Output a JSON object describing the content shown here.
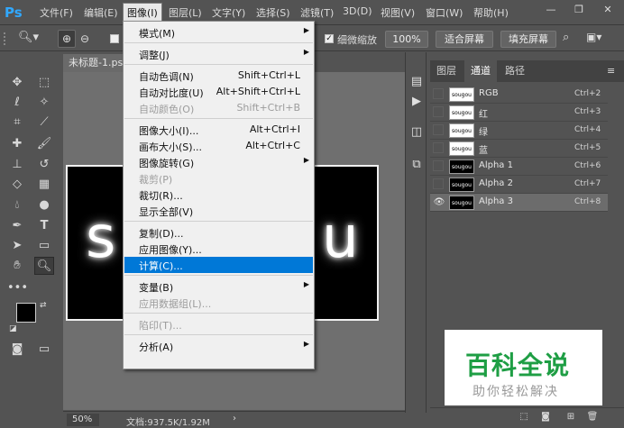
{
  "app": {
    "logo": "Ps",
    "menus": [
      "文件(F)",
      "编辑(E)",
      "图像(I)",
      "图层(L)",
      "文字(Y)",
      "选择(S)",
      "滤镜(T)",
      "3D(D)",
      "视图(V)",
      "窗口(W)",
      "帮助(H)"
    ],
    "active_menu": "图像(I)"
  },
  "options_bar": {
    "checkbox_label": "细微缩放",
    "zoom_value": "100%",
    "fit_screen": "适合屏幕",
    "fill_screen": "填充屏幕"
  },
  "document": {
    "tab_title": "未标题-1.psd",
    "image_text_left": "s",
    "image_text_right": "u",
    "zoom": "50%",
    "doc_info": "文档:937.5K/1.92M"
  },
  "image_menu": {
    "items": [
      {
        "label": "模式(M)",
        "shortcut": "",
        "submenu": true,
        "disabled": false
      },
      {
        "sep": true
      },
      {
        "label": "调整(J)",
        "shortcut": "",
        "submenu": true,
        "disabled": false
      },
      {
        "sep": true
      },
      {
        "label": "自动色调(N)",
        "shortcut": "Shift+Ctrl+L",
        "disabled": false
      },
      {
        "label": "自动对比度(U)",
        "shortcut": "Alt+Shift+Ctrl+L",
        "disabled": false
      },
      {
        "label": "自动颜色(O)",
        "shortcut": "Shift+Ctrl+B",
        "disabled": true
      },
      {
        "sep": true
      },
      {
        "label": "图像大小(I)...",
        "shortcut": "Alt+Ctrl+I",
        "disabled": false
      },
      {
        "label": "画布大小(S)...",
        "shortcut": "Alt+Ctrl+C",
        "disabled": false
      },
      {
        "label": "图像旋转(G)",
        "shortcut": "",
        "submenu": true,
        "disabled": false
      },
      {
        "label": "裁剪(P)",
        "shortcut": "",
        "disabled": true
      },
      {
        "label": "裁切(R)...",
        "shortcut": "",
        "disabled": false
      },
      {
        "label": "显示全部(V)",
        "shortcut": "",
        "disabled": false
      },
      {
        "sep": true
      },
      {
        "label": "复制(D)...",
        "shortcut": "",
        "disabled": false
      },
      {
        "label": "应用图像(Y)...",
        "shortcut": "",
        "disabled": false
      },
      {
        "label": "计算(C)...",
        "shortcut": "",
        "disabled": false,
        "highlighted": true
      },
      {
        "sep": true
      },
      {
        "label": "变量(B)",
        "shortcut": "",
        "submenu": true,
        "disabled": false
      },
      {
        "label": "应用数据组(L)...",
        "shortcut": "",
        "disabled": true
      },
      {
        "sep": true
      },
      {
        "label": "陷印(T)...",
        "shortcut": "",
        "disabled": true
      },
      {
        "sep": true
      },
      {
        "label": "分析(A)",
        "shortcut": "",
        "submenu": true,
        "disabled": false
      }
    ]
  },
  "panel": {
    "tabs": [
      "图层",
      "通道",
      "路径"
    ],
    "active_tab": "通道",
    "thumb_text": "sougou",
    "channels": [
      {
        "name": "RGB",
        "key": "Ctrl+2",
        "thumb": "white",
        "visible": false,
        "selected": false
      },
      {
        "name": "红",
        "key": "Ctrl+3",
        "thumb": "white",
        "visible": false,
        "selected": false
      },
      {
        "name": "绿",
        "key": "Ctrl+4",
        "thumb": "white",
        "visible": false,
        "selected": false
      },
      {
        "name": "蓝",
        "key": "Ctrl+5",
        "thumb": "white",
        "visible": false,
        "selected": false
      },
      {
        "name": "Alpha 1",
        "key": "Ctrl+6",
        "thumb": "black",
        "visible": false,
        "selected": false
      },
      {
        "name": "Alpha 2",
        "key": "Ctrl+7",
        "thumb": "black",
        "visible": false,
        "selected": false
      },
      {
        "name": "Alpha 3",
        "key": "Ctrl+8",
        "thumb": "black",
        "visible": true,
        "selected": true
      }
    ]
  },
  "watermark": {
    "title": "百科全说",
    "subtitle": "助你轻松解决"
  },
  "colors": {
    "highlight": "#0078d7",
    "watermark_green": "#1e9e44"
  }
}
